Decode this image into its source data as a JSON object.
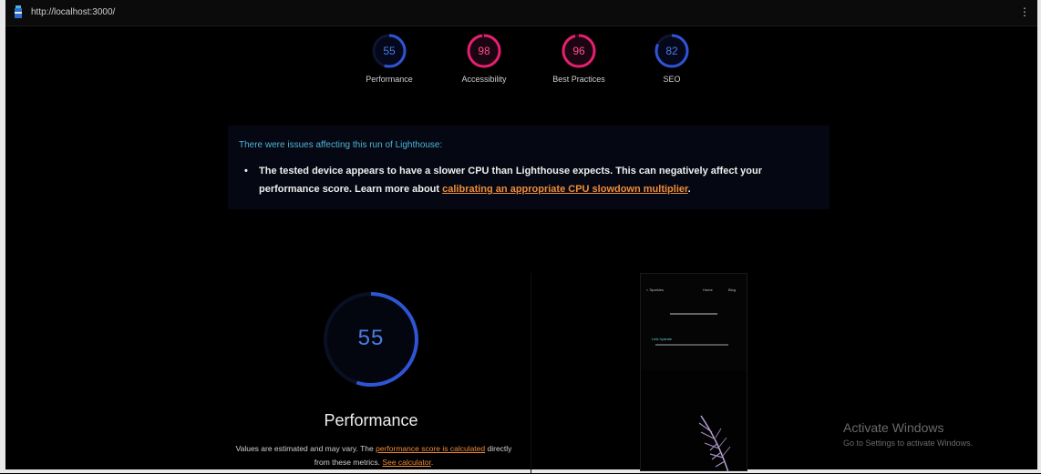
{
  "topbar": {
    "url": "http://localhost:3000/",
    "menu_glyph": "⋮"
  },
  "gauges": [
    {
      "score": "55",
      "label": "Performance",
      "color": "#2f55d4",
      "fraction": 0.55
    },
    {
      "score": "98",
      "label": "Accessibility",
      "color": "#e5206f",
      "fraction": 0.98
    },
    {
      "score": "96",
      "label": "Best Practices",
      "color": "#e5206f",
      "fraction": 0.96
    },
    {
      "score": "82",
      "label": "SEO",
      "color": "#2f55d4",
      "fraction": 0.82
    }
  ],
  "issues": {
    "title": "There were issues affecting this run of Lighthouse:",
    "bullet_text": "The tested device appears to have a slower CPU than Lighthouse expects. This can negatively affect your performance score. Learn more about ",
    "bullet_link": "calibrating an appropriate CPU slowdown multiplier",
    "bullet_end": "."
  },
  "performance": {
    "score": "55",
    "fraction": 0.55,
    "title": "Performance",
    "desc_1": "Values are estimated and may vary. The ",
    "desc_link_1": "performance score is calculated",
    "desc_2": " directly from these metrics. ",
    "desc_link_2": "See calculator",
    "desc_3": "."
  },
  "preview": {
    "nav_left": "< Sparkles",
    "nav_mid": "Home",
    "nav_right": "Blog",
    "teal_text": "Lets hydrate"
  },
  "windows_watermark": {
    "line1": "Activate Windows",
    "line2": "Go to Settings to activate Windows."
  },
  "colors": {
    "accent_orange": "#f08c3a",
    "link_blue": "#4fb3d8",
    "gauge_blue": "#2f55d4",
    "gauge_pink": "#e5206f"
  }
}
